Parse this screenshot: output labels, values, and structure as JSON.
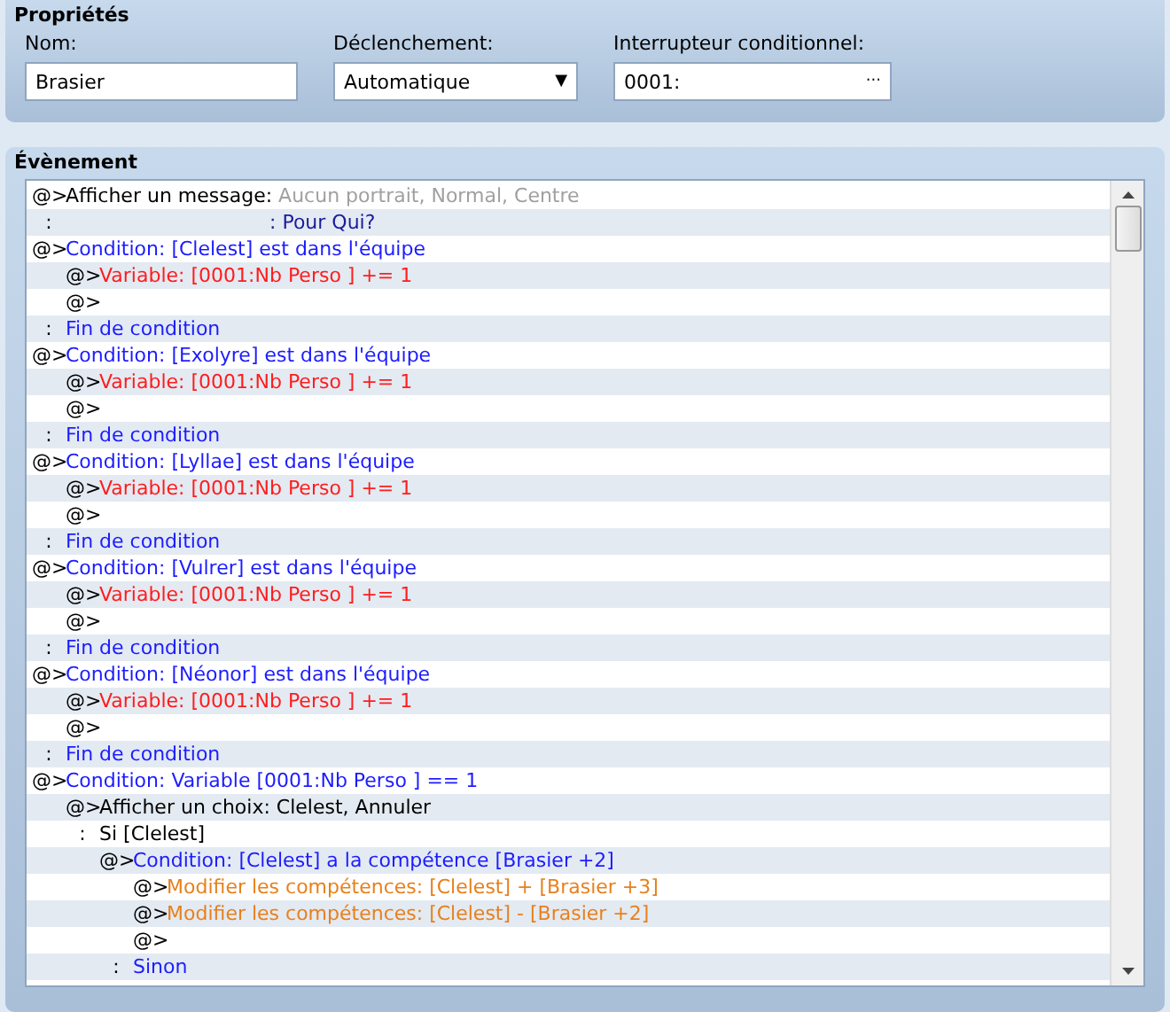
{
  "properties": {
    "title": "Propriétés",
    "fields": [
      {
        "kind": "text",
        "label": "Nom:",
        "value": "Brasier"
      },
      {
        "kind": "dropdown",
        "label": "Déclenchement:",
        "value": "Automatique",
        "button": "▼"
      },
      {
        "kind": "picker",
        "label": "Interrupteur conditionnel:",
        "value": "0001:",
        "button": "···"
      }
    ]
  },
  "event": {
    "title": "Évènement",
    "lines": [
      {
        "prefix": "@>",
        "parts": [
          {
            "kind": "command",
            "text": "Afficher un message:"
          },
          {
            "kind": "detail",
            "text": " Aucun portrait, Normal, Centre"
          }
        ]
      },
      {
        "prefix": ":",
        "parts": [
          {
            "kind": "dialog",
            "text": ": Pour Qui?"
          }
        ]
      },
      {
        "prefix": "@>",
        "parts": [
          {
            "kind": "condition",
            "text": "Condition: [Clelest] est dans l'équipe"
          }
        ],
        "children": [
          {
            "prefix": "@>",
            "parts": [
              {
                "kind": "variable",
                "text": "Variable: [0001:Nb Perso ] += 1"
              }
            ]
          },
          {
            "prefix": "@>"
          }
        ]
      },
      {
        "prefix": ":",
        "parts": [
          {
            "kind": "condition",
            "text": "Fin de condition"
          }
        ]
      },
      {
        "prefix": "@>",
        "parts": [
          {
            "kind": "condition",
            "text": "Condition: [Exolyre] est dans l'équipe"
          }
        ],
        "children": [
          {
            "prefix": "@>",
            "parts": [
              {
                "kind": "variable",
                "text": "Variable: [0001:Nb Perso ] += 1"
              }
            ]
          },
          {
            "prefix": "@>"
          }
        ]
      },
      {
        "prefix": ":",
        "parts": [
          {
            "kind": "condition",
            "text": "Fin de condition"
          }
        ]
      },
      {
        "prefix": "@>",
        "parts": [
          {
            "kind": "condition",
            "text": "Condition: [Lyllae] est dans l'équipe"
          }
        ],
        "children": [
          {
            "prefix": "@>",
            "parts": [
              {
                "kind": "variable",
                "text": "Variable: [0001:Nb Perso ] += 1"
              }
            ]
          },
          {
            "prefix": "@>"
          }
        ]
      },
      {
        "prefix": ":",
        "parts": [
          {
            "kind": "condition",
            "text": "Fin de condition"
          }
        ]
      },
      {
        "prefix": "@>",
        "parts": [
          {
            "kind": "condition",
            "text": "Condition: [Vulrer] est dans l'équipe"
          }
        ],
        "children": [
          {
            "prefix": "@>",
            "parts": [
              {
                "kind": "variable",
                "text": "Variable: [0001:Nb Perso ] += 1"
              }
            ]
          },
          {
            "prefix": "@>"
          }
        ]
      },
      {
        "prefix": ":",
        "parts": [
          {
            "kind": "condition",
            "text": "Fin de condition"
          }
        ]
      },
      {
        "prefix": "@>",
        "parts": [
          {
            "kind": "condition",
            "text": "Condition: [Néonor] est dans l'équipe"
          }
        ],
        "children": [
          {
            "prefix": "@>",
            "parts": [
              {
                "kind": "variable",
                "text": "Variable: [0001:Nb Perso ] += 1"
              }
            ]
          },
          {
            "prefix": "@>"
          }
        ]
      },
      {
        "prefix": ":",
        "parts": [
          {
            "kind": "condition",
            "text": "Fin de condition"
          }
        ]
      },
      {
        "prefix": "@>",
        "parts": [
          {
            "kind": "condition",
            "text": "Condition: Variable [0001:Nb Perso ] == 1"
          }
        ],
        "children": [
          {
            "prefix": "@>",
            "parts": [
              {
                "kind": "command",
                "text": "Afficher un choix: Clelest, Annuler"
              }
            ]
          },
          {
            "prefix": ":",
            "parts": [
              {
                "kind": "command",
                "text": "Si [Clelest]"
              }
            ],
            "children": [
              {
                "prefix": "@>",
                "parts": [
                  {
                    "kind": "condition",
                    "text": "Condition: [Clelest] a la compétence [Brasier +2]"
                  }
                ],
                "children": [
                  {
                    "prefix": "@>",
                    "parts": [
                      {
                        "kind": "skill",
                        "text": "Modifier les compétences: [Clelest] + [Brasier +3]"
                      }
                    ]
                  },
                  {
                    "prefix": "@>",
                    "parts": [
                      {
                        "kind": "skill",
                        "text": "Modifier les compétences: [Clelest] - [Brasier +2]"
                      }
                    ]
                  },
                  {
                    "prefix": "@>"
                  }
                ]
              },
              {
                "prefix": ":",
                "parts": [
                  {
                    "kind": "condition",
                    "text": "Sinon"
                  }
                ]
              }
            ]
          }
        ]
      }
    ]
  }
}
